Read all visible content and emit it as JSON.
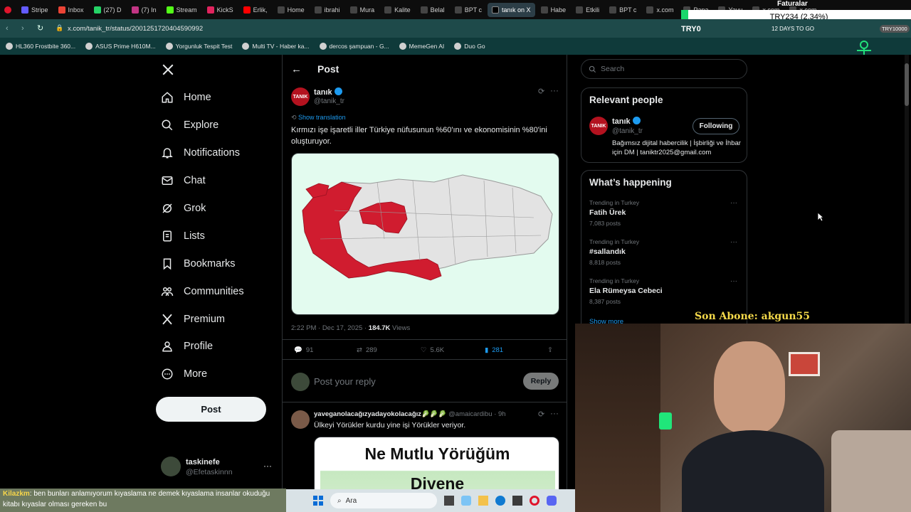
{
  "browser": {
    "tabs": [
      "Stripe",
      "Inbox",
      "(27) D",
      "(7) In",
      "Stream",
      "KickS",
      "Erlik,",
      "Home",
      "ibrahi",
      "Mura",
      "Kalite",
      "Belal",
      "BPT c",
      "tanık on X",
      "Habe",
      "Etkili",
      "BPT c",
      "x.com",
      "Papa",
      "Yavu",
      "x.com",
      "x.com",
      "x.com",
      "x.com"
    ],
    "url": "x.com/tanik_tr/status/2001251720404590992",
    "bookmarks": [
      "HL360 Frostbite 360...",
      "ASUS Prime H610M...",
      "Yorgunluk Tespit Test",
      "Multi TV - Haber ka...",
      "dercos şampuan - G...",
      "MemeGen AI",
      "Duo Go"
    ]
  },
  "stream_overlay": {
    "faturalar": "Faturalar",
    "ticker": "TRY234 (2.34%)",
    "goal_left": "TRY0",
    "goal_days": "12 DAYS TO GO",
    "goal_right": "TRY10000",
    "last_sub": "Son Abone: akgun55",
    "chat_user": "Kilazkm",
    "chat_text": ": ben bunları anlamıyorum kıyaslama ne demek kıyaslama insanlar okuduğu kitabı kıyaslar olması gereken bu",
    "taskbar_search": "Ara"
  },
  "nav": {
    "items": [
      "Home",
      "Explore",
      "Notifications",
      "Chat",
      "Grok",
      "Lists",
      "Bookmarks",
      "Communities",
      "Premium",
      "Profile",
      "More"
    ],
    "post_button": "Post",
    "account_name": "taskinefe",
    "account_handle": "@Efetaskinnn"
  },
  "post": {
    "header": "Post",
    "author_name": "tanık",
    "author_handle": "@tanik_tr",
    "avatar_text": "TANIK",
    "show_translation": "Show translation",
    "text": "Kırmızı işe işaretli iller Türkiye nüfusunun %60'ını ve ekonomisinin %80'ini oluşturuyor.",
    "time": "2:22 PM · Dec 17, 2025 · ",
    "views_count": "184.7K",
    "views_label": " Views",
    "replies": "91",
    "reposts": "289",
    "likes": "5.6K",
    "bookmarks": "281",
    "reply_placeholder": "Post your reply",
    "reply_button": "Reply",
    "map_bg": "#e3fbef",
    "map_red": "#d01c2f"
  },
  "reply_post": {
    "author_name": "yaveganolacağızyadayokolacağız🥬🥬🥬",
    "author_handle": "@amaicardibu",
    "time": "· 9h",
    "text": "Ülkeyi Yörükler kurdu yine işi Yörükler veriyor.",
    "image_title_1": "Ne Mutlu Yörüğüm",
    "image_title_2": "Diyene"
  },
  "right": {
    "search_placeholder": "Search",
    "relevant_title": "Relevant people",
    "person_name": "tanık",
    "person_handle": "@tanik_tr",
    "person_bio": "Bağımsız dijital habercilik | İşbirliği ve İhbar için DM | taniktr2025@gmail.com",
    "follow_button": "Following",
    "happening_title": "What’s happening",
    "trends": [
      {
        "context": "Trending in Turkey",
        "name": "Fatih Ürek",
        "posts": "7,083 posts"
      },
      {
        "context": "Trending in Turkey",
        "name": "#sallandık",
        "posts": "8,818 posts"
      },
      {
        "context": "Trending in Turkey",
        "name": "Ela Rümeysa Cebeci",
        "posts": "8,387 posts"
      }
    ],
    "show_more": "Show more"
  }
}
